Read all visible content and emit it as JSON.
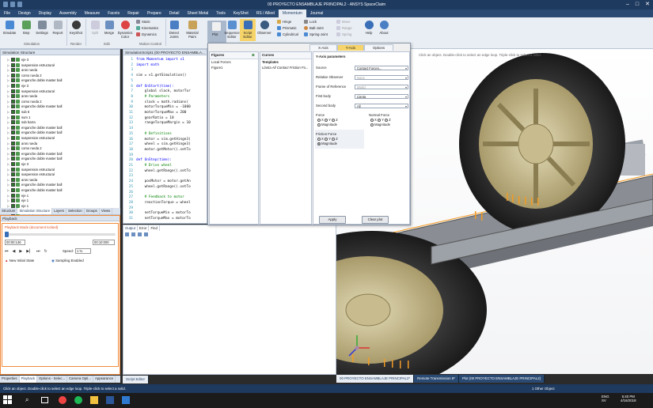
{
  "window": {
    "title": "00 PROYECTO ENSAMBLAJE PRINCIPAL2 - ANSYS SpaceClaim"
  },
  "menu": [
    "File",
    "Design",
    "Display",
    "Assembly",
    "Measure",
    "Facets",
    "Repair",
    "Prepare",
    "Detail",
    "Sheet Metal",
    "Tools",
    "KeyShot",
    "RS / Allied",
    "Momentum",
    "Journal"
  ],
  "menu_active": "Momentum",
  "ribbon": {
    "simulate": "Simulate",
    "step": "Step",
    "settings": "Settings",
    "report": "Report",
    "keyshot": "KeyShot",
    "split": "Split",
    "merge": "Merge",
    "dynamics_color": "Dynamics Color",
    "static": "Static",
    "kinematics": "Kinematics",
    "dynamics": "Dynamics",
    "detect_joints": "Detect Joints",
    "material_pairs": "Material Pairs",
    "hinge": "Hinge",
    "prismatic": "Prismatic",
    "cylindrical": "Cylindrical",
    "lock": "Lock",
    "ball_joint": "Ball-Joint",
    "spring_joint": "Spring-Joint",
    "plot": "Plot",
    "sequence_editor": "Sequence Editor",
    "script_editor": "Script Editor",
    "observer": "Observer",
    "move": "Move",
    "range": "Range",
    "spring": "Spring",
    "help": "Help",
    "about": "About",
    "groups": {
      "simulation": "Simulation",
      "render": "Render",
      "edit": "Edit",
      "motion_control": "Motion Control"
    }
  },
  "sim_structure": {
    "title": "Simulation Structure",
    "items": [
      {
        "label": "eje 3",
        "expand": "▷",
        "checked": true
      },
      {
        "label": "suspension estructural",
        "expand": "▷",
        "checked": true
      },
      {
        "label": "aros rueda",
        "expand": "▷",
        "checked": true
      },
      {
        "label": "como rueda 2",
        "expand": "▷",
        "checked": true
      },
      {
        "label": "enganche doble master ball",
        "expand": "▷",
        "checked": true
      },
      {
        "label": "eje 3",
        "expand": "▷",
        "checked": true
      },
      {
        "label": "suspension estructural",
        "expand": "▷",
        "checked": true
      },
      {
        "label": "aros rueda",
        "expand": "▷",
        "checked": true
      },
      {
        "label": "como rueda 2",
        "expand": "▷",
        "checked": true
      },
      {
        "label": "enganche doble master ball",
        "expand": "▷",
        "checked": true
      },
      {
        "label": "sub 6",
        "expand": "▷",
        "checked": true
      },
      {
        "label": "sum 1",
        "expand": "▷",
        "checked": true
      },
      {
        "label": "sub barra",
        "expand": "▷",
        "checked": true
      },
      {
        "label": "enganche doble master ball",
        "expand": "▷",
        "checked": true
      },
      {
        "label": "enganche doble master ball",
        "expand": "▷",
        "checked": true
      },
      {
        "label": "suspension estructural",
        "expand": "▷",
        "checked": true
      },
      {
        "label": "aros rueda",
        "expand": "▷",
        "checked": true
      },
      {
        "label": "como rueda 2",
        "expand": "▷",
        "checked": true
      },
      {
        "label": "enganche doble master ball",
        "expand": "▷",
        "checked": true
      },
      {
        "label": "enganche doble master ball",
        "expand": "▷",
        "checked": true
      },
      {
        "label": "eje 3",
        "expand": "▷",
        "checked": true
      },
      {
        "label": "suspension estructural",
        "expand": "▷",
        "checked": true
      },
      {
        "label": "suspension estructural",
        "expand": "▷",
        "checked": true
      },
      {
        "label": "aros rueda",
        "expand": "▷",
        "checked": true
      },
      {
        "label": "enganche doble master ball",
        "expand": "▷",
        "checked": true
      },
      {
        "label": "enganche doble master ball",
        "expand": "▷",
        "checked": true
      },
      {
        "label": "eje 1",
        "expand": "▷",
        "checked": true
      },
      {
        "label": "eje 1",
        "expand": "▷",
        "checked": true
      },
      {
        "label": "eje 1",
        "expand": "▷",
        "checked": true
      },
      {
        "label": "Component1",
        "expand": "▷",
        "checked": true,
        "selected": true
      },
      {
        "label": "Simulation Script1",
        "expand": "",
        "checked": true
      }
    ]
  },
  "left_tabs": [
    "Structure",
    "Simulation Structure",
    "Layers",
    "Selection",
    "Groups",
    "Views"
  ],
  "left_tab_active": "Simulation Structure",
  "playback": {
    "title": "Playback",
    "mode": "Playback Mode (document locked)",
    "time_start": "00:00:146",
    "time_end": "00:10:000",
    "speed_label": "Speed:",
    "speed_value": "1 %",
    "new_initial_state": "New Initial State",
    "sampling": "Sampling Enabled",
    "progress": 0.0146
  },
  "bottom_tabs": [
    "Properties",
    "Playback",
    "Options - Selec...",
    "Camera Opti...",
    "Appearance"
  ],
  "bottom_tab_active": "Playback",
  "script": {
    "tab": "SimulationScript1 (00 PROYECTO ENSAMBLA...",
    "lines": [
      {
        "n": "1",
        "t": "from Momentum import v1"
      },
      {
        "n": "2",
        "t": "import math"
      },
      {
        "n": "3",
        "t": ""
      },
      {
        "n": "4",
        "t": "sim = v1.getSimulation()"
      },
      {
        "n": "5",
        "t": ""
      },
      {
        "n": "6",
        "t": "def OnStart(time):"
      },
      {
        "n": "7",
        "t": "    global slack, motorTor"
      },
      {
        "n": "8",
        "t": "    # Parameters"
      },
      {
        "n": "9",
        "t": "    slack = math.radians("
      },
      {
        "n": "10",
        "t": "    motorTorqueMin = -1000"
      },
      {
        "n": "11",
        "t": "    motorTorqueMax = 200"
      },
      {
        "n": "12",
        "t": "    gearRatio = 10"
      },
      {
        "n": "13",
        "t": "    rangeTorqueMargin = 10"
      },
      {
        "n": "14",
        "t": ""
      },
      {
        "n": "15",
        "t": "    # Definitions"
      },
      {
        "n": "16",
        "t": "    motor = sim.getHinge3("
      },
      {
        "n": "17",
        "t": "    wheel = sim.getHinge3("
      },
      {
        "n": "18",
        "t": "    motor.getMotor().setTo"
      },
      {
        "n": "19",
        "t": ""
      },
      {
        "n": "20",
        "t": "def OnStep(time):"
      },
      {
        "n": "21",
        "t": "    # Drive wheel"
      },
      {
        "n": "22",
        "t": "    wheel.getRange().setTo"
      },
      {
        "n": "23",
        "t": ""
      },
      {
        "n": "24",
        "t": "    posMotor = motor.getAn"
      },
      {
        "n": "25",
        "t": "    wheel.getRange().setTo"
      },
      {
        "n": "26",
        "t": ""
      },
      {
        "n": "27",
        "t": "    # Feedback to motor"
      },
      {
        "n": "28",
        "t": "    reactionTorque = wheel"
      },
      {
        "n": "29",
        "t": ""
      },
      {
        "n": "30",
        "t": "    netTorqueMin = motorTo"
      },
      {
        "n": "31",
        "t": "    netTorqueMax = motorTo"
      }
    ],
    "output_tabs": [
      "Output",
      "Error",
      "Find"
    ],
    "editor_tab": "Script Editor"
  },
  "plot_dialog": {
    "tabs": [
      "X-Axis",
      "Y-Axis",
      "Options"
    ],
    "active_tab": "Y-Axis",
    "figures_title": "Figures",
    "figures": [
      "Local Forces",
      "Figure1"
    ],
    "curves_title": "Curves",
    "templates_title": "Templates",
    "curve_item": "Llanta All Contact Friction Fo...",
    "yaxis_title": "Y-Axis parameters",
    "source_label": "Source",
    "source_value": "Contact Forces...",
    "observer_label": "Relative Observer",
    "observer_value": "None",
    "frame_label": "Frame of Reference",
    "frame_value": "World",
    "first_body_label": "First body",
    "first_body_value": "Llanta",
    "second_body_label": "Second body",
    "second_body_value": "All",
    "normal_force": "Normal Force",
    "force": "Force",
    "friction_force": "Friction Force",
    "x": "X",
    "y": "Y",
    "z": "Z",
    "magnitude": "Magnitude",
    "apply": "Apply",
    "clear": "Clear plot"
  },
  "viewport_hint": "Click an object. Double-click to select an edge loop. Triple-click to select a solid.",
  "doc_tabs": [
    "00 PROYECTO ENSAMBLAJE PRINCIPAL2*",
    "Remote Transmission 8*",
    "Plot (00 PROYECTO ENSAMBLAJE PRINCIPAL2)"
  ],
  "status": {
    "text": "Click an object. Double-click to select an edge loop. Triple-click to select a solid.",
    "right": "1 Other Object"
  },
  "taskbar": {
    "lang": "ENG",
    "locale": "SV",
    "time": "5:40 PM",
    "date": "4/16/2018"
  },
  "colors": {
    "brand": "#1e3a5f",
    "accent": "#2a4a73",
    "selection": "#ffe36a",
    "axis_orange": "#f29b24"
  }
}
